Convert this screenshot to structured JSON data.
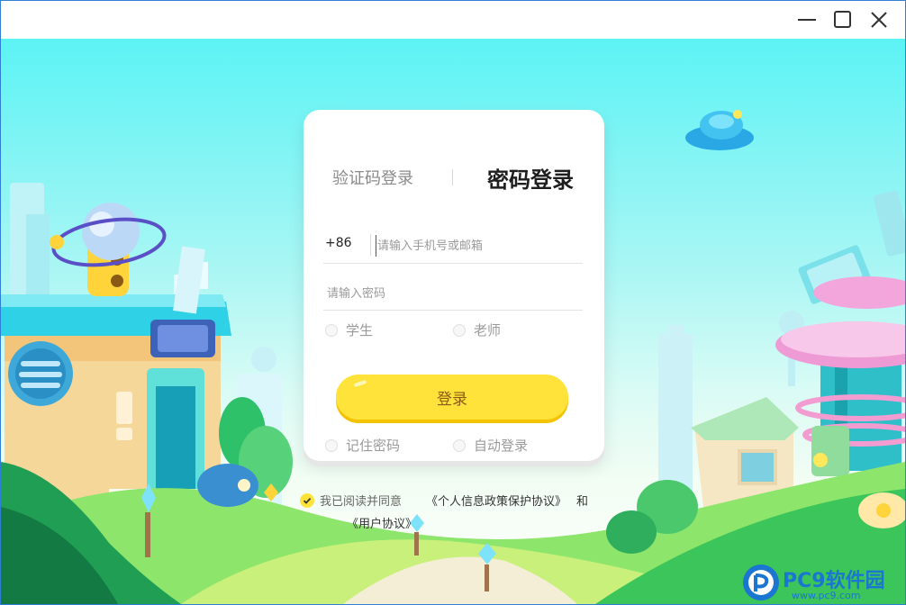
{
  "window": {
    "controls": {
      "minimize_icon": "minimize-icon",
      "maximize_icon": "maximize-icon",
      "close_icon": "close-icon"
    }
  },
  "login": {
    "tabs": {
      "code_login": "验证码登录",
      "password_login": "密码登录",
      "active": "password_login"
    },
    "phone": {
      "country_code": "+86",
      "placeholder": "请输入手机号或邮箱",
      "value": ""
    },
    "password": {
      "placeholder": "请输入密码",
      "value": ""
    },
    "role": {
      "student": "学生",
      "teacher": "老师",
      "selected": ""
    },
    "submit_label": "登录",
    "options": {
      "remember_password": "记住密码",
      "auto_login": "自动登录"
    }
  },
  "agreement": {
    "checked": true,
    "prefix": "我已阅读并同意",
    "privacy_link": "《个人信息政策保护协议》",
    "and": "和",
    "user_link": "《用户协议》"
  },
  "watermark": {
    "name": "PC9软件园",
    "url": "www.pc9.com"
  },
  "colors": {
    "accent_yellow": "#ffe33a",
    "button_text": "#8a5a14",
    "sky_top": "#5cf3f5",
    "watermark_blue": "#1b76d2"
  }
}
